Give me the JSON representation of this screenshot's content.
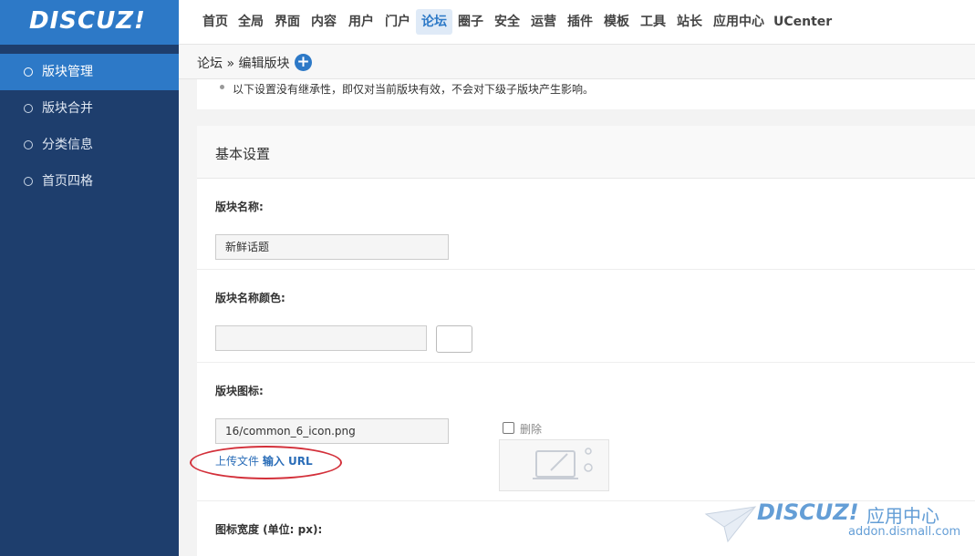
{
  "brand": {
    "logo": "DISCUZ!"
  },
  "topnav": [
    {
      "label": "首页",
      "active": false
    },
    {
      "label": "全局",
      "active": false
    },
    {
      "label": "界面",
      "active": false
    },
    {
      "label": "内容",
      "active": false
    },
    {
      "label": "用户",
      "active": false
    },
    {
      "label": "门户",
      "active": false
    },
    {
      "label": "论坛",
      "active": true
    },
    {
      "label": "圈子",
      "active": false
    },
    {
      "label": "安全",
      "active": false
    },
    {
      "label": "运营",
      "active": false
    },
    {
      "label": "插件",
      "active": false
    },
    {
      "label": "模板",
      "active": false
    },
    {
      "label": "工具",
      "active": false
    },
    {
      "label": "站长",
      "active": false
    },
    {
      "label": "应用中心",
      "active": false
    },
    {
      "label": "UCenter",
      "active": false
    }
  ],
  "sidebar": {
    "items": [
      {
        "label": "版块管理",
        "active": true
      },
      {
        "label": "版块合并",
        "active": false
      },
      {
        "label": "分类信息",
        "active": false
      },
      {
        "label": "首页四格",
        "active": false
      }
    ]
  },
  "breadcrumb": {
    "text": "论坛 » 编辑版块",
    "add_icon": "plus-circle-icon"
  },
  "notice": {
    "text": "以下设置没有继承性，即仅对当前版块有效，不会对下级子版块产生影响。"
  },
  "panel": {
    "title": "基本设置",
    "forum_name": {
      "label": "版块名称:",
      "value": "新鲜话题"
    },
    "forum_name_color": {
      "label": "版块名称颜色:",
      "value": ""
    },
    "forum_icon": {
      "label": "版块图标:",
      "value": "16/common_6_icon.png",
      "delete_label": "删除",
      "upload_link": "上传文件",
      "url_link": "输入 URL"
    },
    "icon_width": {
      "label": "图标宽度 (单位: px):"
    }
  },
  "watermark": {
    "brand": "DISCUZ!",
    "cn": "应用中心",
    "domain": "addon.dismall.com"
  },
  "colors": {
    "sidebar": "#1e3e6d",
    "accent": "#2d79c7",
    "annotation": "#d3303a"
  }
}
